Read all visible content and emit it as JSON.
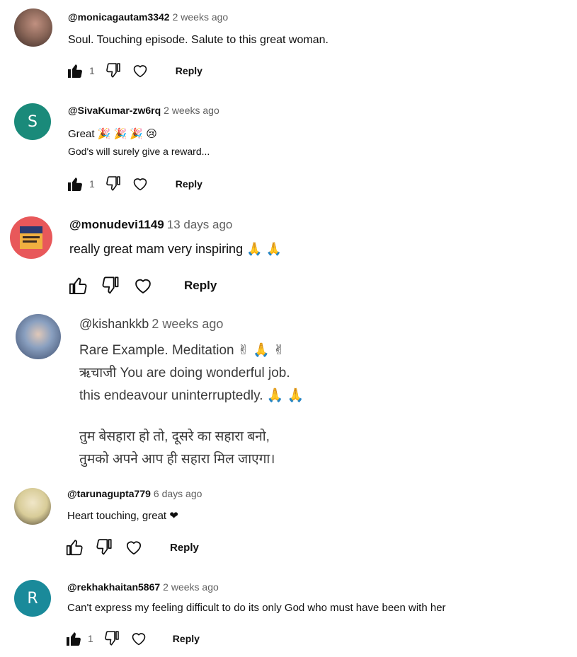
{
  "comments": [
    {
      "handle": "@monicagautam3342",
      "time": "2 weeks ago",
      "lines": [
        "Soul. Touching episode. Salute to this great woman."
      ],
      "likes": "1",
      "liked": true,
      "reply_label": "Reply",
      "avatar": {
        "type": "photo",
        "color": "#6b5045"
      }
    },
    {
      "handle": "@SivaKumar-zw6rq",
      "time": "2 weeks ago",
      "lines": [
        "Great 🎉 🎉 🎉  😢",
        "God's will surely give a reward..."
      ],
      "likes": "1",
      "liked": true,
      "reply_label": "Reply",
      "avatar": {
        "type": "letter",
        "letter": "S",
        "color": "#1a8a7a"
      }
    },
    {
      "handle": "@monudevi1149",
      "time": "13 days ago",
      "lines": [
        "really great mam very inspiring 🙏 🙏"
      ],
      "likes": "",
      "liked": false,
      "reply_label": "Reply",
      "avatar": {
        "type": "photo",
        "color": "#e8585a"
      }
    },
    {
      "handle": "@kishankkb",
      "time": "2 weeks ago",
      "lines": [
        "Rare Example. Meditation ✌ 🙏 ✌",
        "ऋचाजी You are doing wonderful job.",
        "this endeavour uninterruptedly. 🙏 🙏",
        "",
        "तुम बेसहारा हो तो, दूसरे का सहारा बनो,",
        "तुमको अपने आप ही सहारा मिल जाएगा।"
      ],
      "likes": "",
      "liked": false,
      "reply_label": "",
      "avatar": {
        "type": "photo",
        "color": "#8a9bb0"
      }
    },
    {
      "handle": "@tarunagupta779",
      "time": "6 days ago",
      "lines": [
        "Heart touching, great ❤"
      ],
      "likes": "",
      "liked": false,
      "reply_label": "Reply",
      "avatar": {
        "type": "photo",
        "color": "#d9d2b0"
      }
    },
    {
      "handle": "@rekhakhaitan5867",
      "time": "2 weeks ago",
      "lines": [
        "Can't express my feeling difficult to do its only God who must have been with her"
      ],
      "likes": "1",
      "liked": true,
      "reply_label": "Reply",
      "avatar": {
        "type": "letter",
        "letter": "R",
        "color": "#1a8a9a"
      }
    }
  ]
}
